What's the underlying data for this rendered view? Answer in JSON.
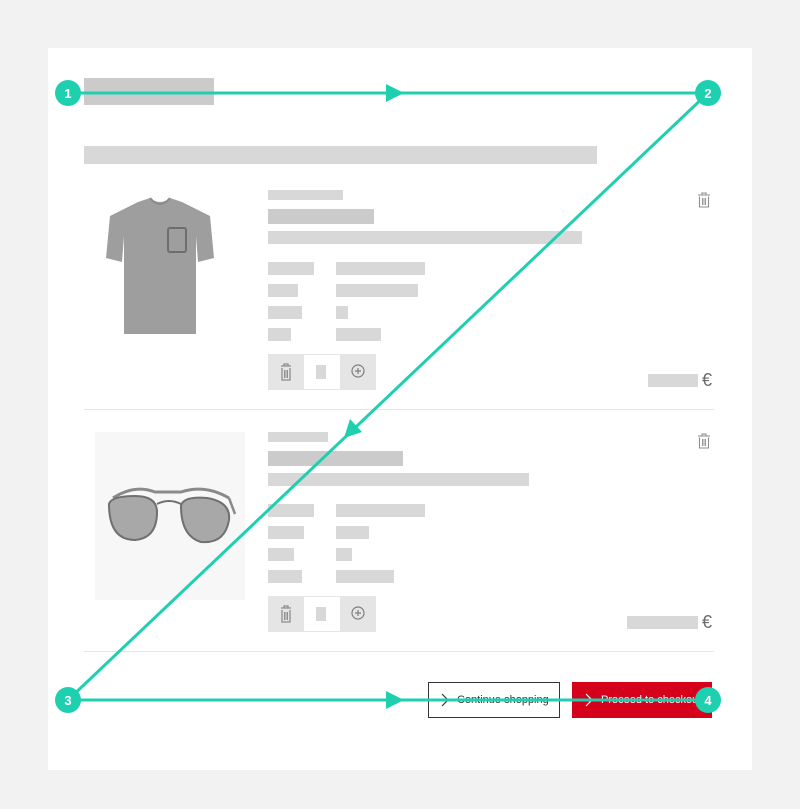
{
  "currency_symbol": "€",
  "buttons": {
    "continue_label": "Continue shopping",
    "checkout_label": "Proceed to checkout"
  },
  "cart_items": [
    {
      "quantity_stepper": true
    },
    {
      "quantity_stepper": true
    }
  ],
  "flow_markers": [
    "1",
    "2",
    "3",
    "4"
  ],
  "colors": {
    "accent_teal": "#1ecfb0",
    "checkout_red": "#d5001c",
    "placeholder_gray": "#d8d8d8"
  }
}
